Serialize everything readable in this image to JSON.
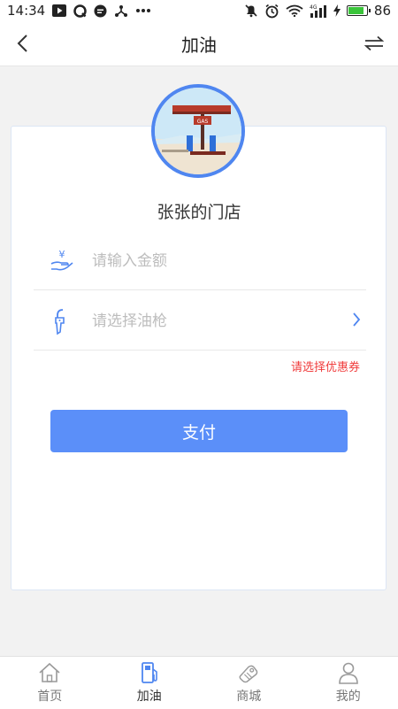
{
  "status_bar": {
    "time": "14:34",
    "battery": "86",
    "network": "4G",
    "battery_level": 0.86
  },
  "header": {
    "title": "加油",
    "back_icon": "chevron-left-icon",
    "switch_icon": "swap-arrows-icon"
  },
  "store": {
    "name": "张张的门店",
    "avatar_sign": "GAS"
  },
  "form": {
    "amount_placeholder": "请输入金额",
    "amount_icon": "yen-hand-icon",
    "gun_placeholder": "请选择油枪",
    "gun_icon": "fuel-nozzle-icon",
    "coupon_label": "请选择优惠券",
    "pay_label": "支付"
  },
  "colors": {
    "accent": "#5b8ff9",
    "coupon": "#f03b3b",
    "avatar_border": "#4f86f0"
  },
  "tabs": [
    {
      "label": "首页",
      "icon": "home-icon",
      "active": false
    },
    {
      "label": "加油",
      "icon": "fuel-pump-icon",
      "active": true
    },
    {
      "label": "商城",
      "icon": "shop-icon",
      "active": false
    },
    {
      "label": "我的",
      "icon": "user-icon",
      "active": false
    }
  ]
}
